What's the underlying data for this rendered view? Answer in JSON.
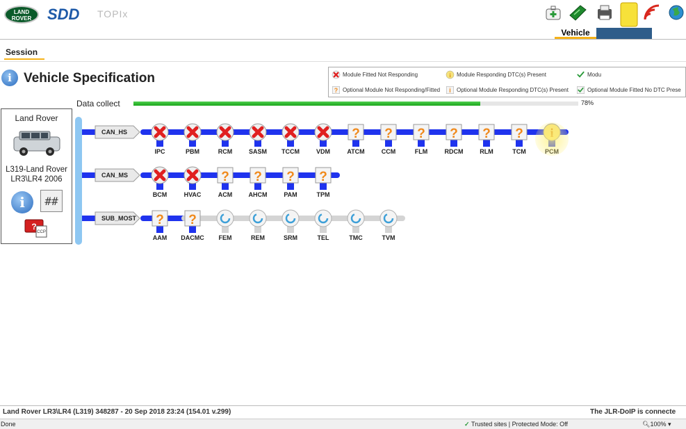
{
  "app": {
    "logo_text": "LAND ROVER",
    "name": "SDD",
    "subtitle": "TOPIx",
    "active_tab": "Vehicle"
  },
  "session": {
    "label": "Session"
  },
  "page": {
    "title": "Vehicle Specification"
  },
  "legend": {
    "items": [
      {
        "text": "Module Fitted Not Responding",
        "icon": "red-x-icon"
      },
      {
        "text": "Module Responding DTC(s) Present",
        "icon": "info-warning-icon"
      },
      {
        "text": "Modu",
        "icon": "green-check-icon"
      },
      {
        "text": "Optional Module Not Responding/Fitted",
        "icon": "question-icon"
      },
      {
        "text": "Optional Module Responding DTC(s) Present",
        "icon": "optional-warning-icon"
      },
      {
        "text": "Optional Module Fitted No DTC Prese",
        "icon": "optional-check-icon"
      }
    ]
  },
  "data_collect": {
    "label": "Data collect",
    "progress_percent": 78,
    "progress_text": "78%"
  },
  "vehicle": {
    "make": "Land Rover",
    "model_line1": "L319-Land Rover",
    "model_line2": "LR3\\LR4 2006",
    "info_icon": "info-icon",
    "hash_icon": "hash-icon",
    "ccp_icon": "ccp-icon"
  },
  "buses": [
    {
      "name": "CAN_HS",
      "modules": [
        {
          "label": "IPC",
          "status": "not-responding"
        },
        {
          "label": "PBM",
          "status": "not-responding"
        },
        {
          "label": "RCM",
          "status": "not-responding"
        },
        {
          "label": "SASM",
          "status": "not-responding"
        },
        {
          "label": "TCCM",
          "status": "not-responding"
        },
        {
          "label": "VDM",
          "status": "not-responding"
        },
        {
          "label": "ATCM",
          "status": "optional"
        },
        {
          "label": "CCM",
          "status": "optional"
        },
        {
          "label": "FLM",
          "status": "optional"
        },
        {
          "label": "RDCM",
          "status": "optional"
        },
        {
          "label": "RLM",
          "status": "optional"
        },
        {
          "label": "TCM",
          "status": "optional"
        },
        {
          "label": "PCM",
          "status": "responding-dtc"
        }
      ]
    },
    {
      "name": "CAN_MS",
      "modules": [
        {
          "label": "BCM",
          "status": "not-responding"
        },
        {
          "label": "HVAC",
          "status": "not-responding"
        },
        {
          "label": "ACM",
          "status": "optional"
        },
        {
          "label": "AHCM",
          "status": "optional"
        },
        {
          "label": "PAM",
          "status": "optional"
        },
        {
          "label": "TPM",
          "status": "optional"
        }
      ]
    },
    {
      "name": "SUB_MOST",
      "modules": [
        {
          "label": "AAM",
          "status": "optional"
        },
        {
          "label": "DACMC",
          "status": "optional"
        },
        {
          "label": "FEM",
          "status": "pending"
        },
        {
          "label": "REM",
          "status": "pending"
        },
        {
          "label": "SRM",
          "status": "pending"
        },
        {
          "label": "TEL",
          "status": "pending"
        },
        {
          "label": "TMC",
          "status": "pending"
        },
        {
          "label": "TVM",
          "status": "pending"
        }
      ]
    }
  ],
  "status_bar": {
    "left": "Land Rover LR3\\LR4 (L319) 348287 - 20 Sep 2018 23:24 (154.01 v.299)",
    "right": "The JLR-DoIP is connecte"
  },
  "browser": {
    "done": "Done",
    "trusted": "Trusted sites | Protected Mode: Off",
    "zoom": "100%"
  },
  "colors": {
    "bus_active": "#1f33ee",
    "bus_pending": "#d4d4d4",
    "accent": "#f5b21a",
    "progress": "#1aa51a"
  }
}
